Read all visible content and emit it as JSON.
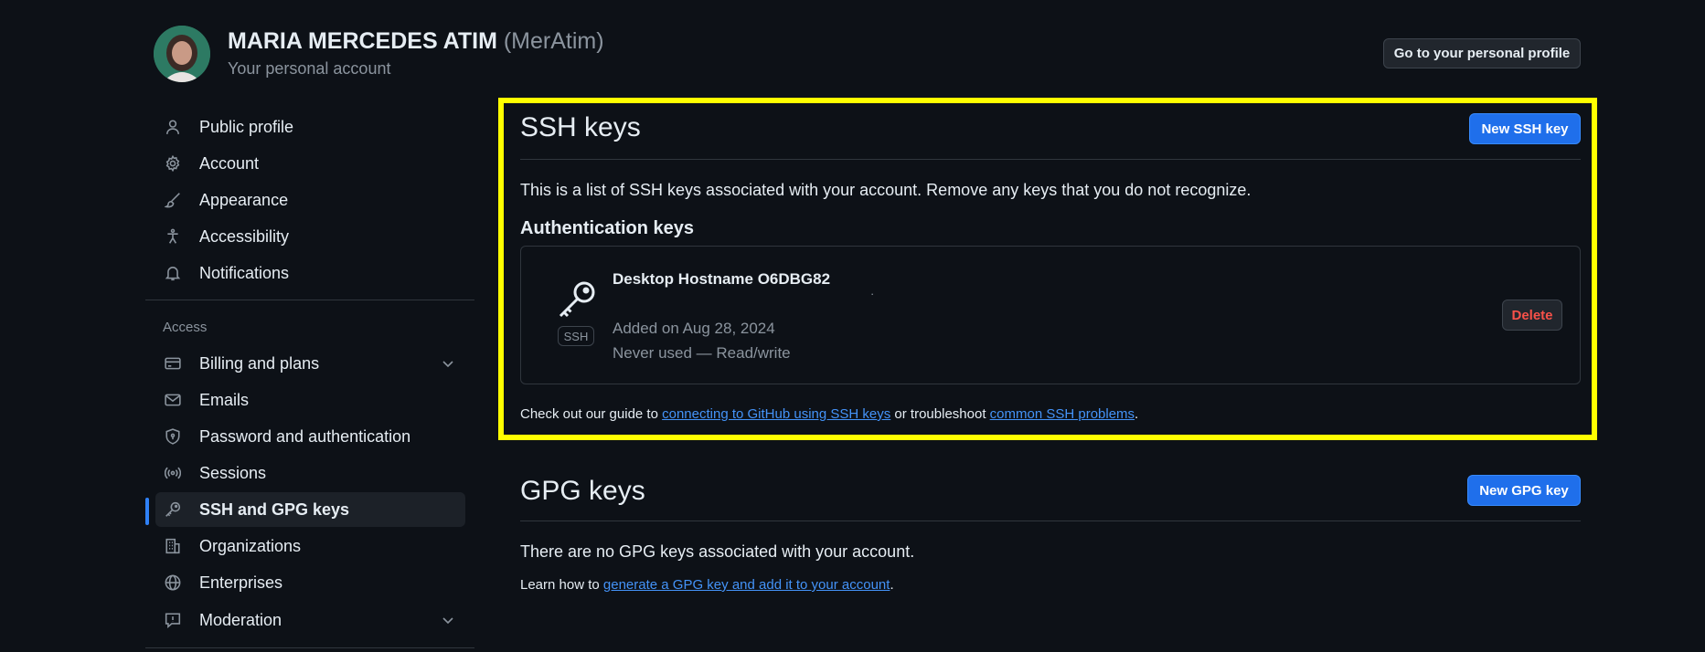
{
  "header": {
    "name": "MARIA MERCEDES ATIM",
    "handle": "(MerAtim)",
    "subtitle": "Your personal account",
    "profile_button": "Go to your personal profile"
  },
  "sidebar": {
    "items": [
      {
        "label": "Public profile",
        "icon": "person-icon"
      },
      {
        "label": "Account",
        "icon": "gear-icon"
      },
      {
        "label": "Appearance",
        "icon": "paintbrush-icon"
      },
      {
        "label": "Accessibility",
        "icon": "accessibility-icon"
      },
      {
        "label": "Notifications",
        "icon": "bell-icon"
      }
    ],
    "access_label": "Access",
    "access_items": [
      {
        "label": "Billing and plans",
        "icon": "credit-card-icon"
      },
      {
        "label": "Emails",
        "icon": "mail-icon"
      },
      {
        "label": "Password and authentication",
        "icon": "shield-icon"
      },
      {
        "label": "Sessions",
        "icon": "broadcast-icon"
      },
      {
        "label": "SSH and GPG keys",
        "icon": "key-icon"
      },
      {
        "label": "Organizations",
        "icon": "organization-icon"
      },
      {
        "label": "Enterprises",
        "icon": "globe-icon"
      },
      {
        "label": "Moderation",
        "icon": "report-icon"
      }
    ]
  },
  "ssh": {
    "title": "SSH keys",
    "new_button": "New SSH key",
    "description": "This is a list of SSH keys associated with your account. Remove any keys that you do not recognize.",
    "auth_heading": "Authentication keys",
    "key": {
      "name": "Desktop Hostname O6DBG82",
      "fingerprint": "·",
      "badge": "SSH",
      "added": "Added on Aug 28, 2024",
      "usage": "Never used — Read/write",
      "delete_button": "Delete"
    },
    "guide": {
      "prefix": "Check out our guide to ",
      "link1": "connecting to GitHub using SSH keys",
      "middle": " or troubleshoot ",
      "link2": "common SSH problems",
      "suffix": "."
    }
  },
  "gpg": {
    "title": "GPG keys",
    "new_button": "New GPG key",
    "empty_text": "There are no GPG keys associated with your account.",
    "learn": {
      "prefix": "Learn how to ",
      "link": "generate a GPG key and add it to your account",
      "suffix": "."
    }
  },
  "colors": {
    "background": "#0d1117",
    "accent": "#1f6feb",
    "highlight": "#ffff00",
    "danger": "#f85149",
    "link": "#4493f8"
  }
}
